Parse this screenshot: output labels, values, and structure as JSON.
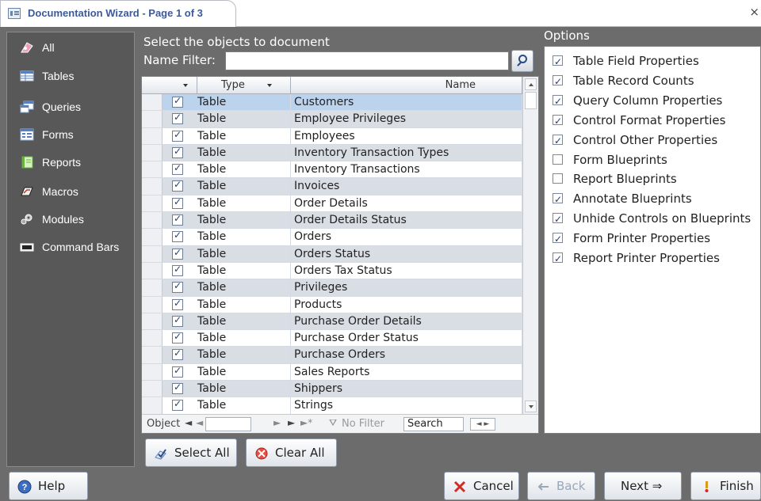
{
  "window": {
    "title": "Documentation Wizard - Page 1 of 3",
    "close_glyph": "×"
  },
  "nav": {
    "items": [
      {
        "label": "All",
        "icon": "all-objects-icon"
      },
      {
        "label": "Tables",
        "icon": "table-icon"
      },
      {
        "label": "Queries",
        "icon": "query-icon"
      },
      {
        "label": "Forms",
        "icon": "form-icon"
      },
      {
        "label": "Reports",
        "icon": "report-icon"
      },
      {
        "label": "Macros",
        "icon": "macro-icon"
      },
      {
        "label": "Modules",
        "icon": "module-icon"
      },
      {
        "label": "Command Bars",
        "icon": "command-bar-icon"
      }
    ]
  },
  "objects": {
    "title": "Select the objects to document",
    "name_filter_label": "Name Filter:",
    "name_filter_value": "",
    "columns": {
      "type": "Type",
      "name": "Name"
    },
    "rows": [
      {
        "type": "Table",
        "name": "Customers",
        "checked": true
      },
      {
        "type": "Table",
        "name": "Employee Privileges",
        "checked": true
      },
      {
        "type": "Table",
        "name": "Employees",
        "checked": true
      },
      {
        "type": "Table",
        "name": "Inventory Transaction Types",
        "checked": true
      },
      {
        "type": "Table",
        "name": "Inventory Transactions",
        "checked": true
      },
      {
        "type": "Table",
        "name": "Invoices",
        "checked": true
      },
      {
        "type": "Table",
        "name": "Order Details",
        "checked": true
      },
      {
        "type": "Table",
        "name": "Order Details Status",
        "checked": true
      },
      {
        "type": "Table",
        "name": "Orders",
        "checked": true
      },
      {
        "type": "Table",
        "name": "Orders Status",
        "checked": true
      },
      {
        "type": "Table",
        "name": "Orders Tax Status",
        "checked": true
      },
      {
        "type": "Table",
        "name": "Privileges",
        "checked": true
      },
      {
        "type": "Table",
        "name": "Products",
        "checked": true
      },
      {
        "type": "Table",
        "name": "Purchase Order Details",
        "checked": true
      },
      {
        "type": "Table",
        "name": "Purchase Order Status",
        "checked": true
      },
      {
        "type": "Table",
        "name": "Purchase Orders",
        "checked": true
      },
      {
        "type": "Table",
        "name": "Sales Reports",
        "checked": true
      },
      {
        "type": "Table",
        "name": "Shippers",
        "checked": true
      },
      {
        "type": "Table",
        "name": "Strings",
        "checked": true
      }
    ],
    "navbar": {
      "record_label": "Object",
      "first": "◄",
      "prev": "◄",
      "next": "►",
      "last": "►",
      "new": "►*",
      "no_filter": "No Filter",
      "search": "Search",
      "hscroll": "◄ ►"
    }
  },
  "options": {
    "title": "Options",
    "items": [
      {
        "label": "Table Field Properties",
        "checked": true
      },
      {
        "label": "Table Record Counts",
        "checked": true
      },
      {
        "label": "Query Column Properties",
        "checked": true
      },
      {
        "label": "Control Format Properties",
        "checked": true
      },
      {
        "label": "Control Other Properties",
        "checked": true
      },
      {
        "label": "Form Blueprints",
        "checked": false
      },
      {
        "label": "Report Blueprints",
        "checked": false
      },
      {
        "label": "Annotate Blueprints",
        "checked": true
      },
      {
        "label": "Unhide Controls on Blueprints",
        "checked": true
      },
      {
        "label": "Form Printer Properties",
        "checked": true
      },
      {
        "label": "Report Printer Properties",
        "checked": true
      }
    ]
  },
  "buttons": {
    "select_all": "Select All",
    "clear_all": "Clear All",
    "help": "Help",
    "cancel": "Cancel",
    "back": "Back",
    "next": "Next ⇒",
    "finish": "Finish"
  },
  "colors": {
    "frame": "#6c6c6c",
    "nav_pane": "#585858",
    "accent_blue": "#3c5a9a",
    "selected_row": "#bcd3ee"
  }
}
